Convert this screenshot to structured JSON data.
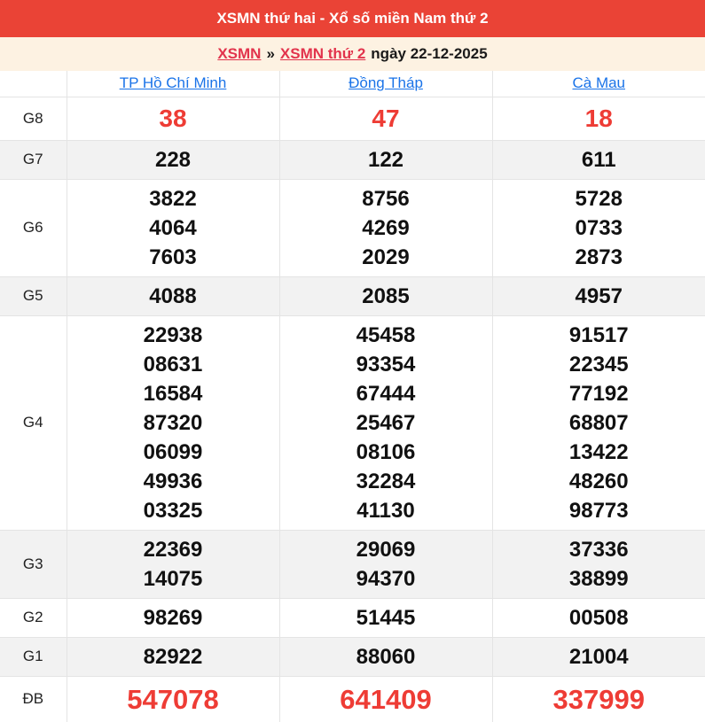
{
  "banner": {
    "title": "XSMN thứ hai - Xổ số miền Nam thứ 2"
  },
  "breadcrumb": {
    "home_link": "XSMN",
    "separator": "»",
    "page_link": "XSMN thứ 2",
    "date_text": "ngày 22-12-2025"
  },
  "results_table": {
    "provinces": [
      "TP Hồ Chí Minh",
      "Đồng Tháp",
      "Cà Mau"
    ],
    "rows": [
      {
        "label": "G8",
        "highlight": "red",
        "cells": [
          [
            "38"
          ],
          [
            "47"
          ],
          [
            "18"
          ]
        ]
      },
      {
        "label": "G7",
        "cells": [
          [
            "228"
          ],
          [
            "122"
          ],
          [
            "611"
          ]
        ]
      },
      {
        "label": "G6",
        "cells": [
          [
            "3822",
            "4064",
            "7603"
          ],
          [
            "8756",
            "4269",
            "2029"
          ],
          [
            "5728",
            "0733",
            "2873"
          ]
        ]
      },
      {
        "label": "G5",
        "cells": [
          [
            "4088"
          ],
          [
            "2085"
          ],
          [
            "4957"
          ]
        ]
      },
      {
        "label": "G4",
        "cells": [
          [
            "22938",
            "08631",
            "16584",
            "87320",
            "06099",
            "49936",
            "03325"
          ],
          [
            "45458",
            "93354",
            "67444",
            "25467",
            "08106",
            "32284",
            "41130"
          ],
          [
            "91517",
            "22345",
            "77192",
            "68807",
            "13422",
            "48260",
            "98773"
          ]
        ]
      },
      {
        "label": "G3",
        "cells": [
          [
            "22369",
            "14075"
          ],
          [
            "29069",
            "94370"
          ],
          [
            "37336",
            "38899"
          ]
        ]
      },
      {
        "label": "G2",
        "cells": [
          [
            "98269"
          ],
          [
            "51445"
          ],
          [
            "00508"
          ]
        ]
      },
      {
        "label": "G1",
        "cells": [
          [
            "82922"
          ],
          [
            "88060"
          ],
          [
            "21004"
          ]
        ]
      },
      {
        "label": "ĐB",
        "highlight": "red-lg",
        "cells": [
          [
            "547078"
          ],
          [
            "641409"
          ],
          [
            "337999"
          ]
        ]
      }
    ]
  },
  "colors": {
    "banner_red": "#ea4336",
    "number_red": "#ee3c35",
    "link_red": "#e2334c",
    "link_blue": "#1a73e8",
    "breadcrumb_bg": "#fdf2e2",
    "row_alt_bg": "#f2f2f2"
  }
}
